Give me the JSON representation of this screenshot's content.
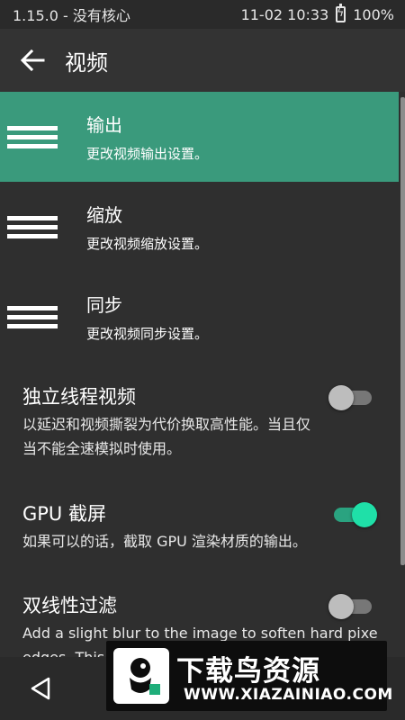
{
  "status_bar": {
    "left_text": "1.15.0 - 没有核心",
    "datetime": "11-02 10:33",
    "battery_percent": "100%"
  },
  "app_bar": {
    "title": "视频",
    "back_icon": "arrow-left-icon"
  },
  "menu_items": [
    {
      "title": "输出",
      "subtitle": "更改视频输出设置。",
      "icon": "hamburger-icon",
      "active": true
    },
    {
      "title": "缩放",
      "subtitle": "更改视频缩放设置。",
      "icon": "hamburger-icon",
      "active": false
    },
    {
      "title": "同步",
      "subtitle": "更改视频同步设置。",
      "icon": "hamburger-icon",
      "active": false
    }
  ],
  "toggles": [
    {
      "title": "独立线程视频",
      "desc_lines": [
        "以延迟和视频撕裂为代价换取高性能。当且仅",
        "当不能全速模拟时使用。"
      ],
      "on": false
    },
    {
      "title": "GPU 截屏",
      "desc_lines": [
        "如果可以的话，截取 GPU 渲染材质的输出。"
      ],
      "on": true
    },
    {
      "title": "双线性过滤",
      "desc_lines": [
        "Add a slight blur to the image to soften hard pixe",
        "edges. This"
      ],
      "on": false
    }
  ],
  "nav_bar": {
    "back_icon": "triangle-back-icon"
  },
  "watermark": {
    "title": "下载鸟资源",
    "url": "WWW.XIAZAINIAO.COM",
    "logo_icon": "bird-logo-icon"
  },
  "colors": {
    "accent": "#3a9a7c",
    "switch_on": "#1fe0a8",
    "background": "#2f2f2f"
  }
}
